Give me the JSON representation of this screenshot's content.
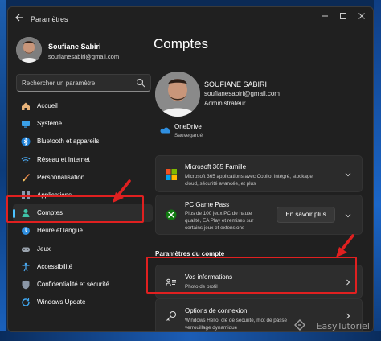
{
  "app": {
    "title": "Paramètres"
  },
  "profile": {
    "name": "Soufiane Sabiri",
    "email": "soufianesabiri@gmail.com"
  },
  "search": {
    "placeholder": "Rechercher un paramètre"
  },
  "sidebar": {
    "items": [
      {
        "label": "Accueil",
        "icon": "home-icon"
      },
      {
        "label": "Système",
        "icon": "monitor-icon"
      },
      {
        "label": "Bluetooth et appareils",
        "icon": "bluetooth-icon"
      },
      {
        "label": "Réseau et Internet",
        "icon": "wifi-icon"
      },
      {
        "label": "Personnalisation",
        "icon": "brush-icon"
      },
      {
        "label": "Applications",
        "icon": "apps-icon"
      },
      {
        "label": "Comptes",
        "icon": "person-icon",
        "active": true
      },
      {
        "label": "Heure et langue",
        "icon": "clock-globe-icon"
      },
      {
        "label": "Jeux",
        "icon": "gamepad-icon"
      },
      {
        "label": "Accessibilité",
        "icon": "accessibility-icon"
      },
      {
        "label": "Confidentialité et sécurité",
        "icon": "shield-icon"
      },
      {
        "label": "Windows Update",
        "icon": "update-icon"
      }
    ]
  },
  "main": {
    "title": "Comptes",
    "account": {
      "name": "SOUFIANE SABIRI",
      "email": "soufianesabiri@gmail.com",
      "role": "Administrateur"
    },
    "onedrive": {
      "label": "OneDrive",
      "status": "Sauvegardé"
    },
    "cards": {
      "m365": {
        "title": "Microsoft 365 Famille",
        "desc1": "Microsoft 365 applications avec Copilot intégré, stockage",
        "desc2": "cloud, sécurité avancée, et plus"
      },
      "gamepass": {
        "title": "PC Game Pass",
        "desc1": "Plus de 100 jeux PC de haute",
        "desc2": "qualité, EA Play et remises sur",
        "desc3": "certains jeux et extensions",
        "button": "En savoir plus"
      },
      "section_label": "Paramètres du compte",
      "info": {
        "title": "Vos informations",
        "desc": "Photo de profil"
      },
      "options": {
        "title": "Options de connexion",
        "desc1": "Windows Hello, clé de sécurité, mot de passe",
        "desc2": "verrouillage dynamique"
      }
    }
  },
  "watermark": {
    "text": "EasyTutoriel"
  },
  "colors": {
    "accent": "#4cc2ff",
    "highlight": "#e02020",
    "window_bg": "#202020"
  }
}
